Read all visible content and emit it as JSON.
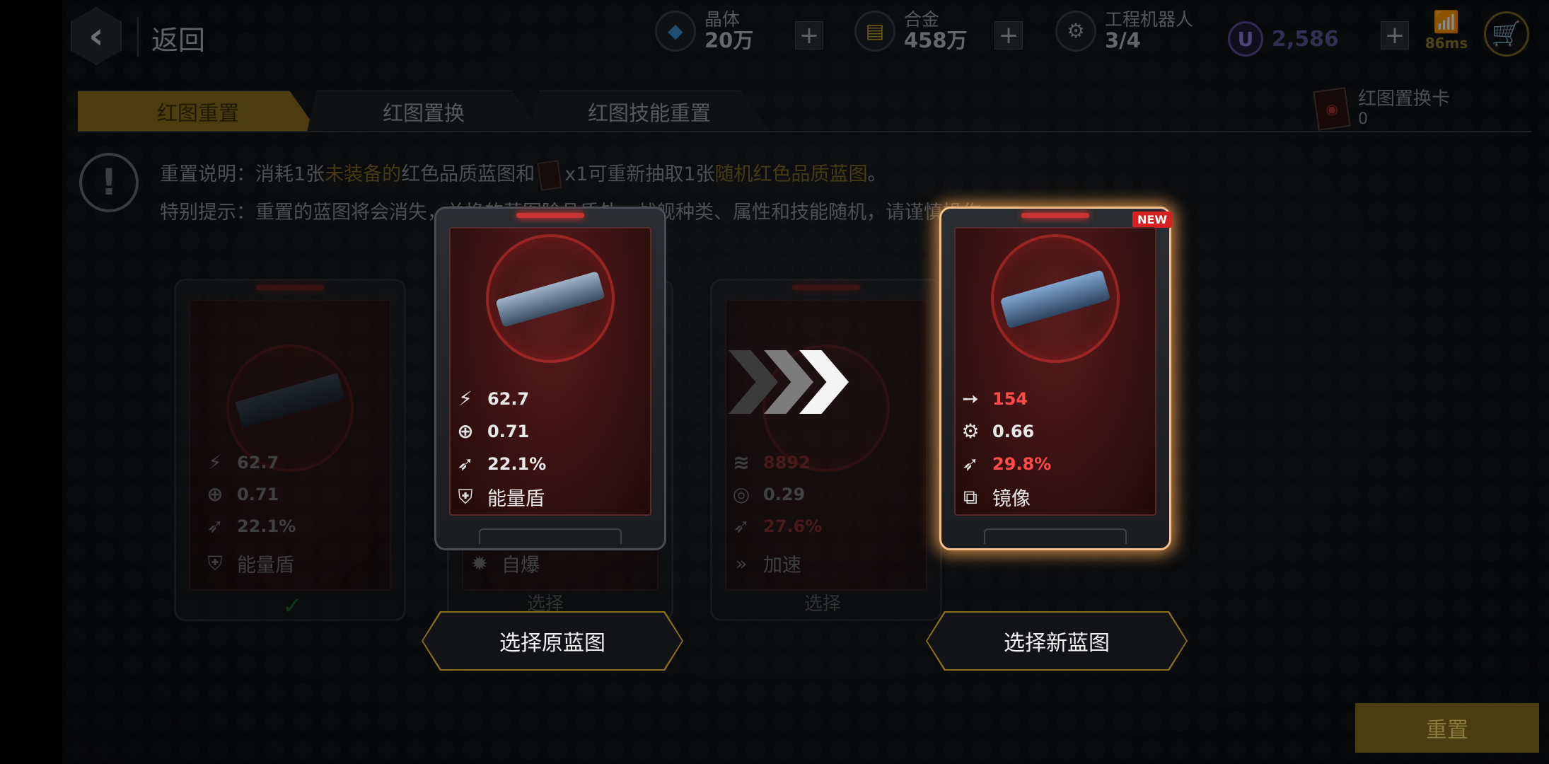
{
  "topbar": {
    "back_label": "返回",
    "resources": [
      {
        "name": "晶体",
        "value": "20万",
        "icon": "crystal-icon"
      },
      {
        "name": "合金",
        "value": "458万",
        "icon": "alloy-icon"
      },
      {
        "name": "工程机器人",
        "value": "3/4",
        "icon": "robot-icon"
      }
    ],
    "u_currency": "2,586",
    "latency": "86ms"
  },
  "tabs": [
    {
      "label": "红图重置",
      "active": true
    },
    {
      "label": "红图置换",
      "active": false
    },
    {
      "label": "红图技能重置",
      "active": false
    }
  ],
  "inventory": {
    "name": "红图置换卡",
    "count": "0"
  },
  "info": {
    "line1_a": "重置说明：消耗1张",
    "line1_b": "未装备的",
    "line1_c": "红色品质蓝图和",
    "line1_d": "x1可重新抽取1张",
    "line1_e": "随机红色品质蓝图",
    "line1_f": "。",
    "line2": "特别提示：重置的蓝图将会消失，兑换的蓝图除品质外，战舰种类、属性和技能随机，请谨慎操作。"
  },
  "cards": {
    "bg_left": {
      "stat1": "62.7",
      "stat2": "0.71",
      "stat3": "22.1%",
      "skill": "能量盾"
    },
    "bg_mid": {
      "skill": "自爆",
      "select": "选择"
    },
    "bg_right": {
      "stat1": "8892",
      "stat2": "0.29",
      "stat3": "27.6%",
      "skill": "加速",
      "select": "选择"
    },
    "original": {
      "stat1": "62.7",
      "stat2": "0.71",
      "stat3": "22.1%",
      "skill": "能量盾"
    },
    "new": {
      "badge": "NEW",
      "stat1": "154",
      "stat2": "0.66",
      "stat3": "29.8%",
      "skill": "镜像"
    }
  },
  "buttons": {
    "select_original": "选择原蓝图",
    "select_new": "选择新蓝图",
    "reset": "重置"
  }
}
